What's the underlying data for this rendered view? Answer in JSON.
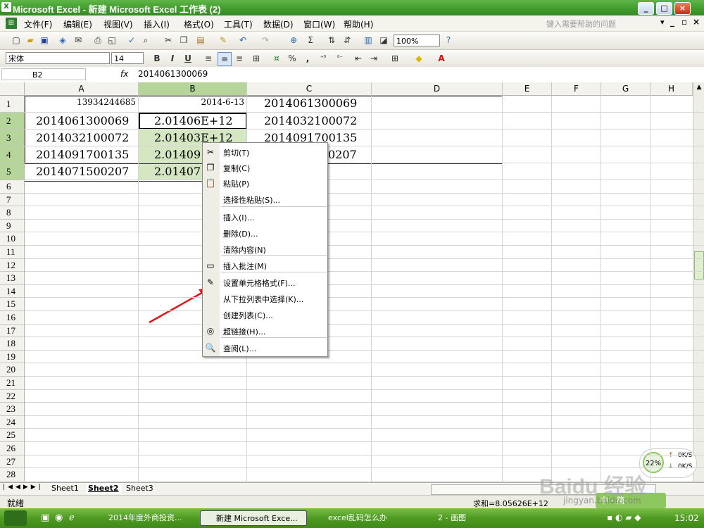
{
  "window": {
    "title": "Microsoft Excel - 新建 Microsoft Excel 工作表 (2)",
    "app_icon": "X",
    "controls": [
      "_",
      "□",
      "×"
    ]
  },
  "menubar": {
    "items": [
      "文件(F)",
      "编辑(E)",
      "视图(V)",
      "插入(I)",
      "格式(O)",
      "工具(T)",
      "数据(D)",
      "窗口(W)",
      "帮助(H)"
    ],
    "help_placeholder": "键入需要帮助的问题",
    "doc_controls": [
      "▾",
      "_",
      "▫",
      "×"
    ]
  },
  "toolbar_standard": {
    "zoom": "100%"
  },
  "toolbar_format": {
    "font_name": "宋体",
    "font_size": "14",
    "bold": "B",
    "italic": "I",
    "underline": "U",
    "percent": "%",
    "comma": ","
  },
  "formula_bar": {
    "name_box": "B2",
    "fx_label": "fx",
    "content": "2014061300069"
  },
  "columns": [
    "A",
    "B",
    "C",
    "D",
    "E",
    "F",
    "G",
    "H"
  ],
  "rows": [
    "1",
    "2",
    "3",
    "4",
    "5",
    "6",
    "7",
    "8",
    "9",
    "10",
    "11",
    "12",
    "13",
    "14",
    "15",
    "16",
    "17",
    "18",
    "19",
    "20",
    "21",
    "22",
    "23",
    "24",
    "25",
    "26",
    "27",
    "28"
  ],
  "cells": {
    "A1": "13934244685",
    "B1": "2014-6-13",
    "C1": "2014061300069",
    "A2": "2014061300069",
    "B2": "2.01406E+12",
    "C2": "2014032100072",
    "A3": "2014032100072",
    "B3": "2.01403E+12",
    "C3": "2014091700135",
    "A4": "2014091700135",
    "B4": "2.01409",
    "C4": "0207",
    "A5": "2014071500207",
    "B5": "2.01407"
  },
  "context_menu": {
    "items": [
      {
        "label": "剪切(T)",
        "icon": "scissors-icon",
        "glyph": "✂"
      },
      {
        "label": "复制(C)",
        "icon": "copy-icon",
        "glyph": "❐"
      },
      {
        "label": "粘贴(P)",
        "icon": "paste-icon",
        "glyph": "📋"
      },
      {
        "label": "选择性粘贴(S)...",
        "icon": "",
        "glyph": ""
      },
      {
        "label": "插入(I)...",
        "icon": "",
        "glyph": ""
      },
      {
        "label": "删除(D)...",
        "icon": "",
        "glyph": ""
      },
      {
        "label": "清除内容(N)",
        "icon": "",
        "glyph": ""
      },
      {
        "label": "插入批注(M)",
        "icon": "comment-folder-icon",
        "glyph": "▭"
      },
      {
        "label": "设置单元格格式(F)...",
        "icon": "format-cells-icon",
        "glyph": "✎"
      },
      {
        "label": "从下拉列表中选择(K)...",
        "icon": "",
        "glyph": ""
      },
      {
        "label": "创建列表(C)...",
        "icon": "",
        "glyph": ""
      },
      {
        "label": "超链接(H)...",
        "icon": "hyperlink-icon",
        "glyph": "◎"
      },
      {
        "label": "查阅(L)...",
        "icon": "lookup-icon",
        "glyph": "🔍"
      }
    ],
    "highlighted": "设置单元格格式(F)..."
  },
  "sheet_tabs": [
    "Sheet1",
    "Sheet2",
    "Sheet3"
  ],
  "status": {
    "ready": "就绪",
    "sum": "求和=8.05626E+12"
  },
  "net_widget": {
    "cpu": "22%",
    "up": "0K/S",
    "down": "0K/S"
  },
  "watermark": {
    "line1": "Baidu 经验",
    "line2": "jingyan.baidu.com"
  },
  "taskbar": {
    "tasks": [
      "2014年度外商投资...",
      "新建 Microsoft Exce...",
      "excel乱码怎么办",
      "2 - 画图"
    ],
    "active": "新建 Microsoft Exce...",
    "clock": "15:02"
  },
  "colors": {
    "title_green": "#3f9a2c",
    "selected_header": "#b6d59a",
    "annotation_red": "#d81818"
  }
}
